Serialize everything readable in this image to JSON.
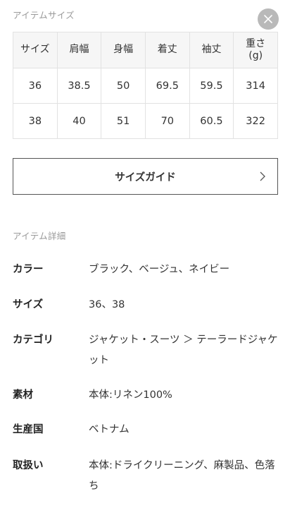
{
  "size_section": {
    "heading": "アイテムサイズ",
    "table": {
      "headers": [
        "サイズ",
        "肩幅",
        "身幅",
        "着丈",
        "袖丈",
        "重さ\n(g)"
      ],
      "rows": [
        [
          "36",
          "38.5",
          "50",
          "69.5",
          "59.5",
          "314"
        ],
        [
          "38",
          "40",
          "51",
          "70",
          "60.5",
          "322"
        ]
      ]
    },
    "size_guide_label": "サイズガイド"
  },
  "detail_section": {
    "heading": "アイテム詳細",
    "items": [
      {
        "key": "カラー",
        "value": "ブラック、ベージュ、ネイビー"
      },
      {
        "key": "サイズ",
        "value": "36、38"
      },
      {
        "key": "カテゴリ",
        "value": "ジャケット・スーツ ＞ テーラードジャケット"
      },
      {
        "key": "素材",
        "value": "本体:リネン100%"
      },
      {
        "key": "生産国",
        "value": "ベトナム"
      },
      {
        "key": "取扱い",
        "value": "本体:ドライクリーニング、麻製品、色落ち"
      }
    ]
  },
  "icons": {
    "close": "close-icon",
    "chevron": "chevron-right-icon"
  },
  "colors": {
    "close_button_bg": "#b9b9b9",
    "table_header_bg": "#f6f6f6",
    "heading_gray": "#9a9a9a"
  }
}
